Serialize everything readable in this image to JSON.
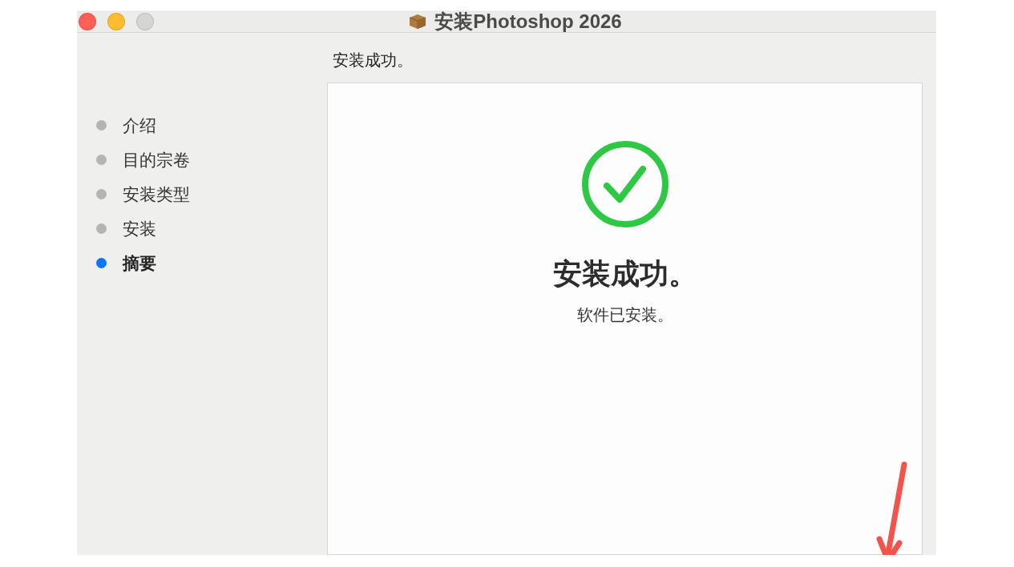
{
  "window": {
    "title": "安装Photoshop 2026",
    "buttons": [
      {
        "kind": "close",
        "disabled": false
      },
      {
        "kind": "minimize",
        "disabled": false
      },
      {
        "kind": "zoom",
        "disabled": true
      }
    ]
  },
  "sidebar": {
    "steps": [
      {
        "label": "介绍",
        "selected": false
      },
      {
        "label": "目的宗卷",
        "selected": false
      },
      {
        "label": "安装类型",
        "selected": false
      },
      {
        "label": "安装",
        "selected": false
      },
      {
        "label": "摘要",
        "selected": true
      }
    ]
  },
  "header": "安装成功。",
  "panel": {
    "heading": "安装成功。",
    "message": "软件已安装。"
  }
}
